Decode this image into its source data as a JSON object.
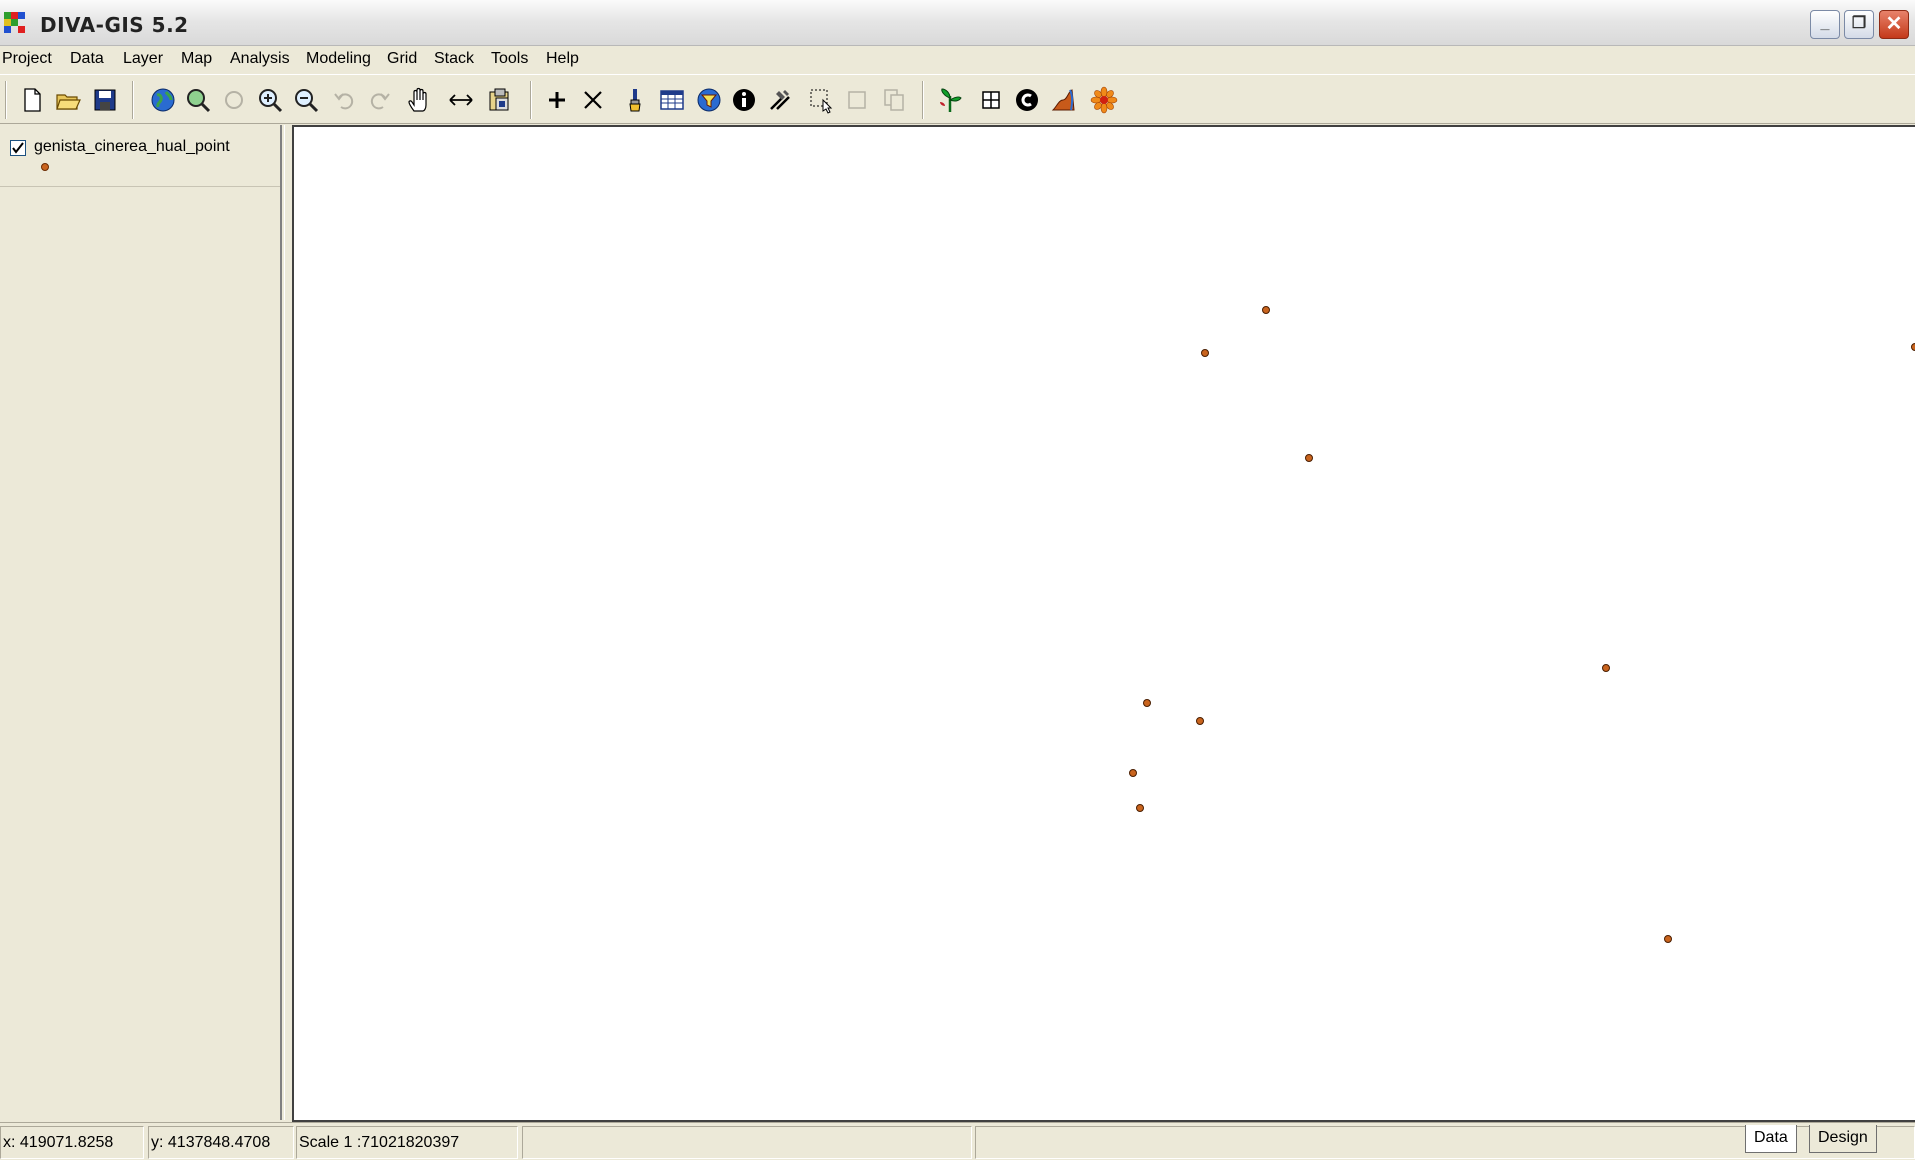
{
  "window": {
    "title": "DIVA-GIS 5.2",
    "controls": {
      "minimize": "_",
      "restore": "❐",
      "close": "✕"
    }
  },
  "menu": [
    "Project",
    "Data",
    "Layer",
    "Map",
    "Analysis",
    "Modeling",
    "Grid",
    "Stack",
    "Tools",
    "Help"
  ],
  "toolbar": {
    "buttons": [
      {
        "name": "new-project",
        "icon": "new-file-icon",
        "enabled": true
      },
      {
        "name": "open",
        "icon": "open-folder-icon",
        "enabled": true
      },
      {
        "name": "save",
        "icon": "save-icon",
        "enabled": true
      },
      {
        "name": "full-extent",
        "icon": "globe-icon",
        "enabled": true
      },
      {
        "name": "zoom-to-layer",
        "icon": "zoom-layer-icon",
        "enabled": true
      },
      {
        "name": "zoom-selected",
        "icon": "zoom-selection-icon",
        "enabled": false
      },
      {
        "name": "zoom-in",
        "icon": "zoom-in-icon",
        "enabled": true
      },
      {
        "name": "zoom-out",
        "icon": "zoom-out-icon",
        "enabled": true
      },
      {
        "name": "undo-zoom",
        "icon": "undo-icon",
        "enabled": false
      },
      {
        "name": "redo-zoom",
        "icon": "redo-icon",
        "enabled": false
      },
      {
        "name": "pan",
        "icon": "hand-icon",
        "enabled": true
      },
      {
        "name": "measure",
        "icon": "measure-icon",
        "enabled": true
      },
      {
        "name": "copy-map",
        "icon": "copy-map-icon",
        "enabled": true
      },
      {
        "name": "add-layer",
        "icon": "plus-icon",
        "enabled": true
      },
      {
        "name": "remove-layer",
        "icon": "cross-icon",
        "enabled": true
      },
      {
        "name": "properties",
        "icon": "brush-icon",
        "enabled": true
      },
      {
        "name": "attribute-table",
        "icon": "table-icon",
        "enabled": true
      },
      {
        "name": "query",
        "icon": "query-icon",
        "enabled": true
      },
      {
        "name": "identify",
        "icon": "info-icon",
        "enabled": true
      },
      {
        "name": "tools",
        "icon": "hammer-icon",
        "enabled": true
      },
      {
        "name": "select",
        "icon": "select-icon",
        "enabled": true
      },
      {
        "name": "clear-selection",
        "icon": "clear-selection-icon",
        "enabled": false
      },
      {
        "name": "copy-selection",
        "icon": "copy-selection-icon",
        "enabled": false
      },
      {
        "name": "point-to-grid",
        "icon": "plant-icon",
        "enabled": true
      },
      {
        "name": "grid",
        "icon": "grid-icon",
        "enabled": true
      },
      {
        "name": "circle-tool",
        "icon": "c-circle-icon",
        "enabled": true
      },
      {
        "name": "climate",
        "icon": "climate-icon",
        "enabled": true
      },
      {
        "name": "about",
        "icon": "flower-icon",
        "enabled": true
      }
    ]
  },
  "legend": {
    "layers": [
      {
        "name": "genista_cinerea_hual_point",
        "visible": true,
        "symbol_color": "#c9641e"
      }
    ]
  },
  "map": {
    "point_color": "#c9641e"
  },
  "status": {
    "x": "x: 419071.8258",
    "y": "y: 4137848.4708",
    "scale": "Scale 1 :71021820397"
  },
  "tabs": [
    {
      "label": "Data",
      "active": true
    },
    {
      "label": "Design",
      "active": false
    }
  ]
}
